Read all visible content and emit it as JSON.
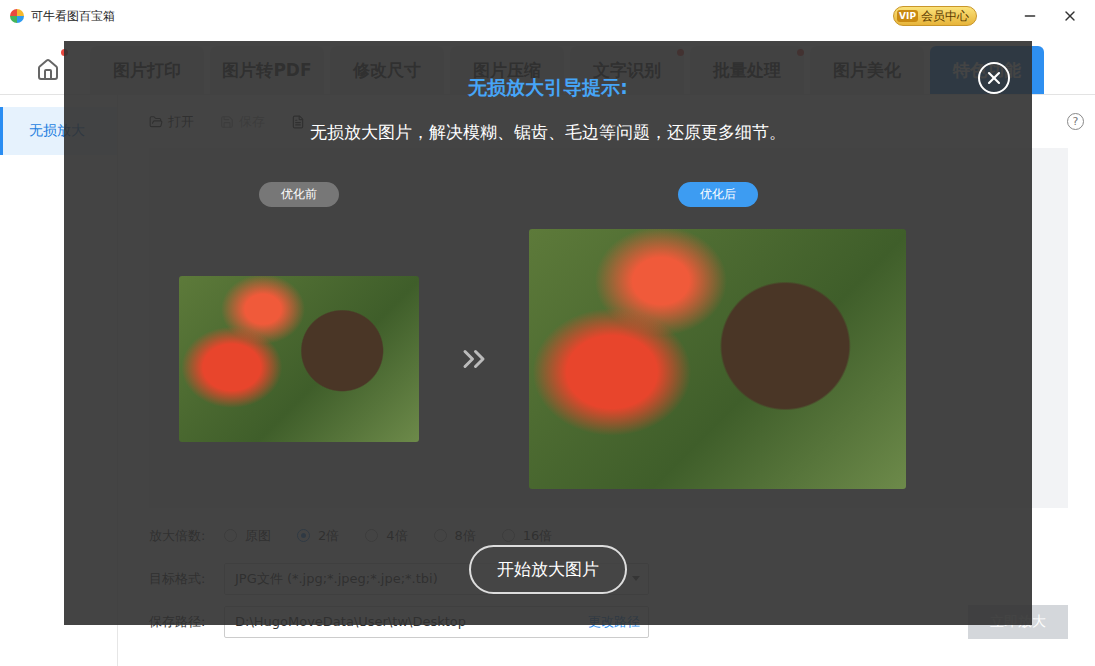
{
  "window": {
    "title": "可牛看图百宝箱"
  },
  "member": {
    "badge": "VIP",
    "label": "会员中心"
  },
  "home": {
    "dot": true
  },
  "tabs": [
    {
      "label": "图片打印",
      "selected": false,
      "dot": false
    },
    {
      "label": "图片转PDF",
      "selected": false,
      "dot": false
    },
    {
      "label": "修改尺寸",
      "selected": false,
      "dot": false
    },
    {
      "label": "图片压缩",
      "selected": false,
      "dot": false
    },
    {
      "label": "文字识别",
      "selected": false,
      "dot": true
    },
    {
      "label": "批量处理",
      "selected": false,
      "dot": true
    },
    {
      "label": "图片美化",
      "selected": false,
      "dot": false
    },
    {
      "label": "特色功能",
      "selected": true,
      "dot": false
    }
  ],
  "sidebar": {
    "items": [
      {
        "label": "无损放大",
        "selected": true
      }
    ]
  },
  "toolbar": [
    {
      "label": "打开",
      "disabled": false
    },
    {
      "label": "保存",
      "disabled": true
    }
  ],
  "help": "?",
  "options": {
    "scale": {
      "label": "放大倍数:",
      "choices": [
        {
          "label": "原图",
          "selected": false
        },
        {
          "label": "2倍",
          "selected": true
        },
        {
          "label": "4倍",
          "selected": false
        },
        {
          "label": "8倍",
          "selected": false
        },
        {
          "label": "16倍",
          "selected": false
        }
      ]
    },
    "format": {
      "label": "目标格式:",
      "value": "JPG文件 (*.jpg;*.jpeg;*.jpe;*.tbi)"
    },
    "path": {
      "label": "保存路径:",
      "value": "D:\\HugoMoveData\\User\\tw\\Desktop",
      "link": "更改路径"
    }
  },
  "action": {
    "label": "立即放大",
    "disabled": true
  },
  "guide": {
    "title": "无损放大引导提示:",
    "description": "无损放大图片，解决模糊、锯齿、毛边等问题，还原更多细节。",
    "before": "优化前",
    "after": "优化后",
    "button": "开始放大图片"
  }
}
